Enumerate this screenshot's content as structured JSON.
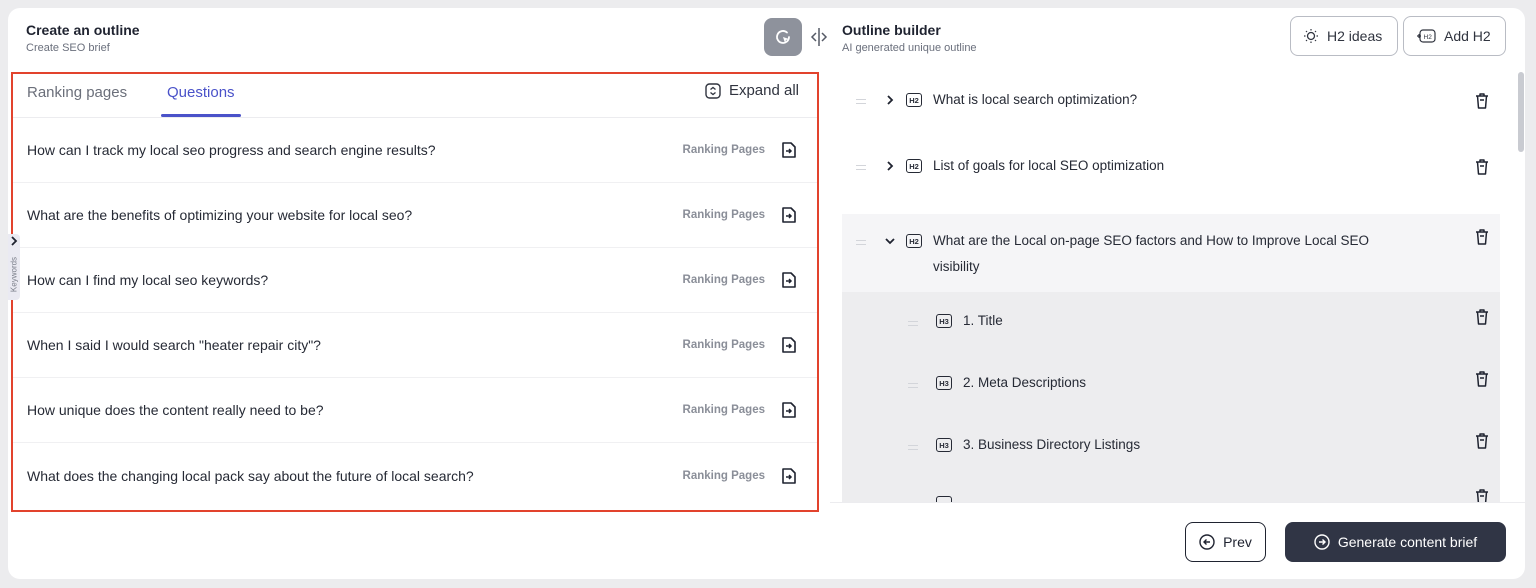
{
  "left_panel": {
    "title": "Create an outline",
    "subtitle": "Create SEO brief",
    "tabs": [
      {
        "label": "Ranking pages",
        "active": false
      },
      {
        "label": "Questions",
        "active": true
      }
    ],
    "expand_label": "Expand all",
    "side_tab_label": "Keywords",
    "questions": [
      {
        "text": "How can I track my local seo progress and search engine results?",
        "tag": "Ranking Pages"
      },
      {
        "text": "What are the benefits of optimizing your website for local seo?",
        "tag": "Ranking Pages"
      },
      {
        "text": "How can I find my local seo keywords?",
        "tag": "Ranking Pages"
      },
      {
        "text": "When I said I would search \"heater repair city\"?",
        "tag": "Ranking Pages"
      },
      {
        "text": "How unique does the content really need to be?",
        "tag": "Ranking Pages"
      },
      {
        "text": "What does the changing local pack say about the future of local search?",
        "tag": "Ranking Pages"
      }
    ]
  },
  "right_panel": {
    "title": "Outline builder",
    "subtitle": "AI generated unique outline",
    "h2_ideas_label": "H2 ideas",
    "add_h2_label": "Add H2",
    "badge_h2": "H2",
    "badge_h3": "H3",
    "h2_items": [
      {
        "text": "What is local search optimization?",
        "expanded": false
      },
      {
        "text": "List of goals for local SEO optimization",
        "expanded": false
      },
      {
        "text_line1": "What  are the Local on-page SEO factors and How to Improve Local SEO",
        "text_line2": "visibility",
        "expanded": true
      }
    ],
    "h3_items": [
      {
        "text": "1. Title"
      },
      {
        "text": "2. Meta Descriptions"
      },
      {
        "text": "3. Business Directory Listings"
      }
    ]
  },
  "footer": {
    "prev_label": "Prev",
    "generate_label": "Generate content brief"
  },
  "colors": {
    "accent": "#4a52c9",
    "highlight_border": "#e2432d",
    "primary_button": "#303545"
  }
}
